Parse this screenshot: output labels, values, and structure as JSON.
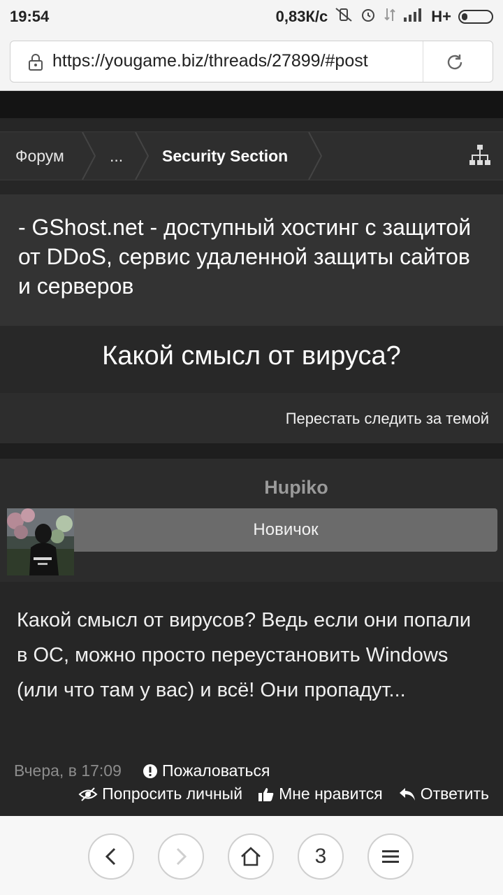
{
  "status_bar": {
    "time": "19:54",
    "speed": "0,83К/с",
    "network": "H+"
  },
  "browser": {
    "url": "https://yougame.biz/threads/27899/#post"
  },
  "breadcrumb": {
    "items": [
      "Форум",
      "...",
      "Security Section"
    ]
  },
  "promo": {
    "text": "- GShost.net - доступный хостинг с защитой от DDoS, сервис удаленной защиты сайтов и серверов"
  },
  "thread": {
    "title": "Какой смысл от вируса?",
    "unwatch_label": "Перестать следить за темой"
  },
  "post": {
    "author": "Hupiko",
    "role": "Новичок",
    "text": "Какой смысл от вирусов? Ведь если они попали в ОС, можно просто переустановить Windows (или что там у вас) и всё! Они пропадут...",
    "date": "Вчера, в 17:09",
    "report_label": "Пожаловаться",
    "actions": {
      "private": "Попросить личный",
      "like": "Мне нравится",
      "reply": "Ответить"
    }
  },
  "bottom_nav": {
    "tabs_count": "3"
  }
}
